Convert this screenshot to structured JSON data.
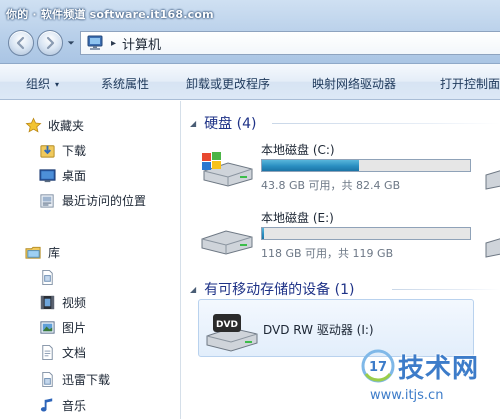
{
  "watermark_top": "你的 · 软件频道 software.it168.com",
  "address": {
    "crumb": "计算机",
    "separator": "▸"
  },
  "toolbar": {
    "organize": "组织",
    "organize_arrow": "▾",
    "system_properties": "系统属性",
    "uninstall_program": "卸载或更改程序",
    "map_network_drive": "映射网络驱动器",
    "open_control_panel": "打开控制面"
  },
  "sidebar": {
    "favorites": "收藏夹",
    "favorite_items": [
      "下载",
      "桌面",
      "最近访问的位置"
    ],
    "libraries": "库",
    "library_items": [
      "视频",
      "图片",
      "文档",
      "迅雷下载",
      "音乐"
    ]
  },
  "content": {
    "hard_disks_group": "硬盘 (4)",
    "drives": [
      {
        "name": "本地磁盘 (C:)",
        "free_text": "43.8 GB 可用，共 82.4 GB",
        "used_fraction": 0.468
      },
      {
        "name": "本地磁盘 (E:)",
        "free_text": "118 GB 可用，共 119 GB",
        "used_fraction": 0.008
      }
    ],
    "removable_group": "有可移动存储的设备 (1)",
    "dvd": {
      "name": "DVD RW 驱动器 (I:)",
      "label": "DVD"
    }
  },
  "watermark_logo": {
    "brand": "技术网",
    "badge": "17",
    "url": "www.itjs.cn"
  },
  "colors": {
    "group_title": "#1e3287",
    "capacity_bar": "#2a8fc1",
    "watermark": "#3d7cc9"
  }
}
